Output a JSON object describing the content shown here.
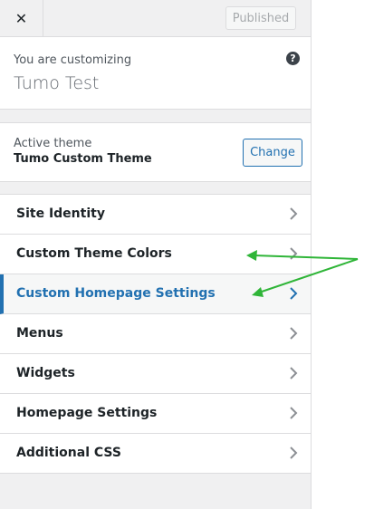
{
  "header": {
    "close_icon": "close-icon",
    "published_label": "Published"
  },
  "customizing": {
    "subtitle": "You are customizing",
    "site_title": "Tumo Test",
    "help_glyph": "?"
  },
  "active_theme": {
    "label": "Active theme",
    "name": "Tumo Custom Theme",
    "change_label": "Change"
  },
  "sections": [
    {
      "label": "Site Identity",
      "active": false
    },
    {
      "label": "Custom Theme Colors",
      "active": false
    },
    {
      "label": "Custom Homepage Settings",
      "active": true
    },
    {
      "label": "Menus",
      "active": false
    },
    {
      "label": "Widgets",
      "active": false
    },
    {
      "label": "Homepage Settings",
      "active": false
    },
    {
      "label": "Additional CSS",
      "active": false
    }
  ],
  "colors": {
    "accent": "#2271b1",
    "annotation_arrow": "#2fb538"
  }
}
